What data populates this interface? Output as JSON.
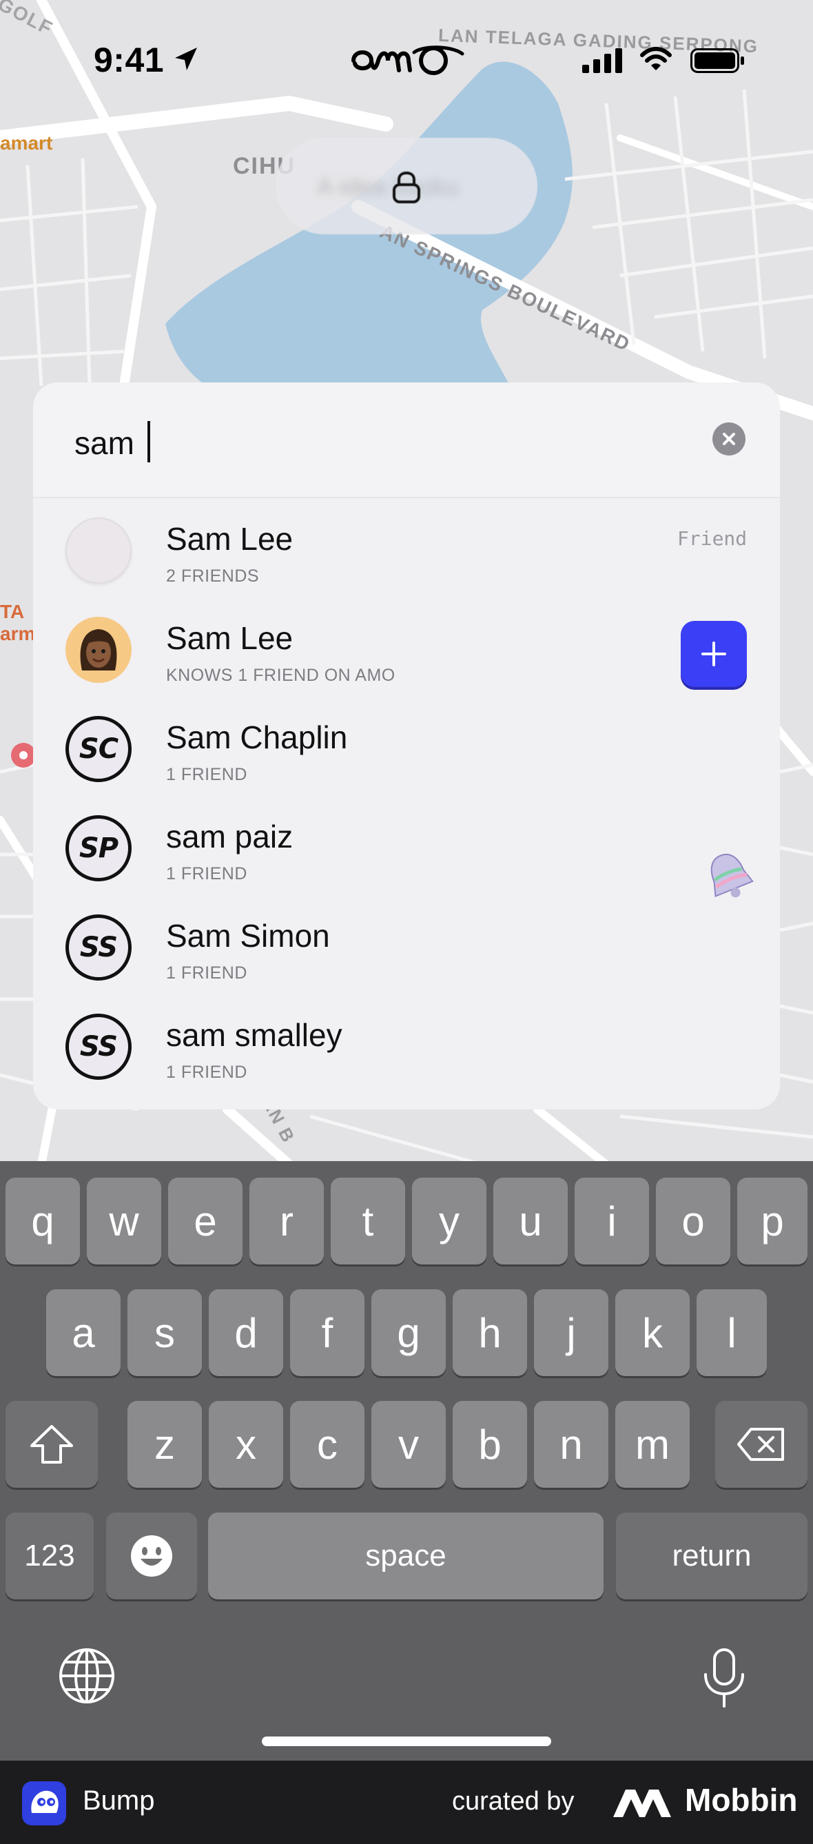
{
  "status_bar": {
    "time": "9:41",
    "app_name": "amo"
  },
  "map": {
    "labels": [
      "GOLF",
      "LAN TELAGA GADING SERPONG",
      "CIHU",
      "AN SPRINGS BOULEVARD",
      "amart",
      "TA",
      "arm",
      "AN B"
    ],
    "colors": {
      "land": "#e3e3e5",
      "water": "#a9c9e0",
      "road": "#ffffff"
    }
  },
  "lock_pill": {
    "text": "A idea basku"
  },
  "search": {
    "query": "sam",
    "clear_icon": "xmark-circle-icon"
  },
  "results": [
    {
      "name": "Sam Lee",
      "subtitle": "2 FRIENDS",
      "avatar": "blank",
      "initials": "",
      "tag": "Friend"
    },
    {
      "name": "Sam Lee",
      "subtitle": "KNOWS 1 FRIEND ON AMO",
      "avatar": "memoji",
      "initials": "",
      "action": "+"
    },
    {
      "name": "Sam Chaplin",
      "subtitle": "1 FRIEND",
      "avatar": "initials",
      "initials": "SC"
    },
    {
      "name": "sam paiz",
      "subtitle": "1 FRIEND",
      "avatar": "initials",
      "initials": "SP"
    },
    {
      "name": "Sam Simon",
      "subtitle": "1 FRIEND",
      "avatar": "initials",
      "initials": "SS"
    },
    {
      "name": "sam smalley",
      "subtitle": "1 FRIEND",
      "avatar": "initials",
      "initials": "SS"
    }
  ],
  "keyboard": {
    "row1": [
      "q",
      "w",
      "e",
      "r",
      "t",
      "y",
      "u",
      "i",
      "o",
      "p"
    ],
    "row2": [
      "a",
      "s",
      "d",
      "f",
      "g",
      "h",
      "j",
      "k",
      "l"
    ],
    "row3": [
      "z",
      "x",
      "c",
      "v",
      "b",
      "n",
      "m"
    ],
    "numbers_key": "123",
    "space_key": "space",
    "return_key": "return"
  },
  "banner": {
    "app": "Bump",
    "curated_by": "curated by",
    "brand": "Mobbin"
  },
  "colors": {
    "accent_blue": "#3b3ff5",
    "keyboard_bg": "#5f5f62",
    "key_bg": "#8b8b8e"
  }
}
